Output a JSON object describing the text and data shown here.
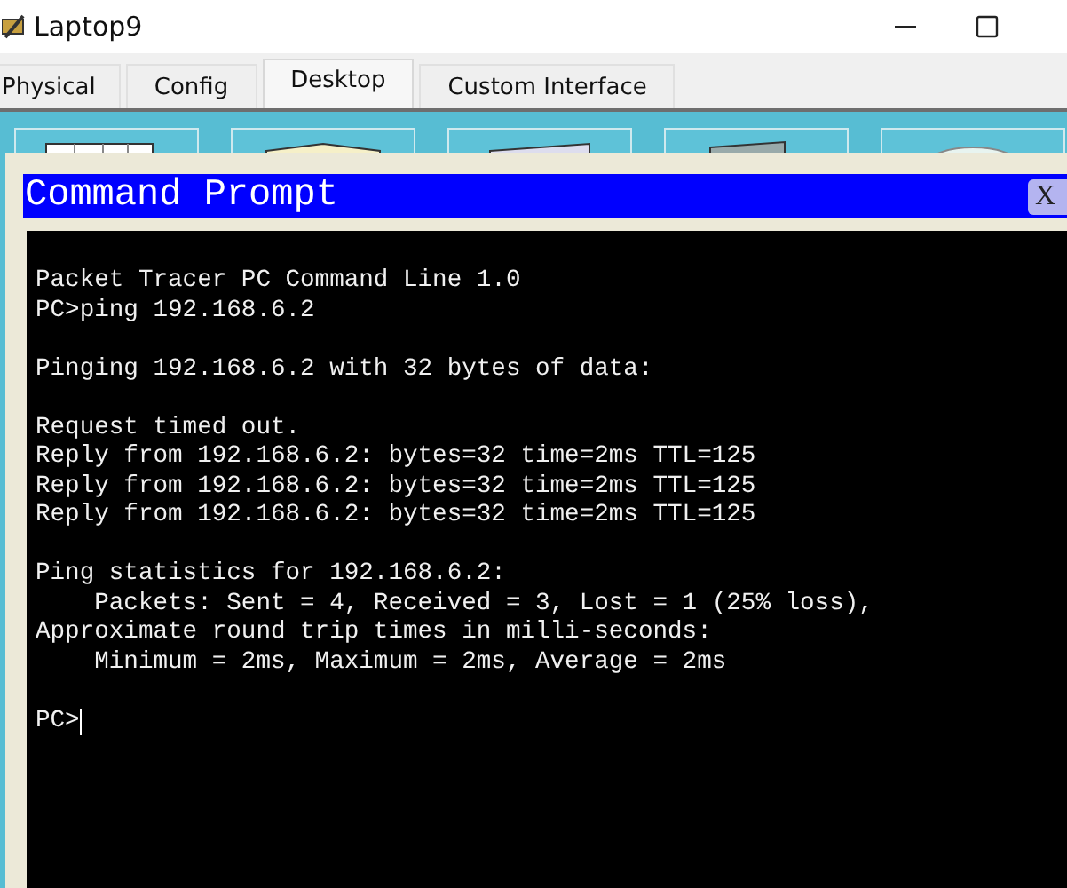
{
  "window": {
    "title": "Laptop9"
  },
  "tabs": [
    {
      "label": "Physical",
      "selected": false
    },
    {
      "label": "Config",
      "selected": false
    },
    {
      "label": "Desktop",
      "selected": true
    },
    {
      "label": "Custom Interface",
      "selected": false
    }
  ],
  "command_prompt": {
    "title": "Command Prompt",
    "close": "X",
    "output_blocks": [
      [
        "Packet Tracer PC Command Line 1.0",
        "PC>ping 192.168.6.2"
      ],
      [
        "Pinging 192.168.6.2 with 32 bytes of data:"
      ],
      [
        "Request timed out.",
        "Reply from 192.168.6.2: bytes=32 time=2ms TTL=125",
        "Reply from 192.168.6.2: bytes=32 time=2ms TTL=125",
        "Reply from 192.168.6.2: bytes=32 time=2ms TTL=125"
      ],
      [
        "Ping statistics for 192.168.6.2:",
        "    Packets: Sent = 4, Received = 3, Lost = 1 (25% loss),",
        "Approximate round trip times in milli-seconds:",
        "    Minimum = 2ms, Maximum = 2ms, Average = 2ms"
      ],
      [
        "PC>"
      ]
    ]
  }
}
